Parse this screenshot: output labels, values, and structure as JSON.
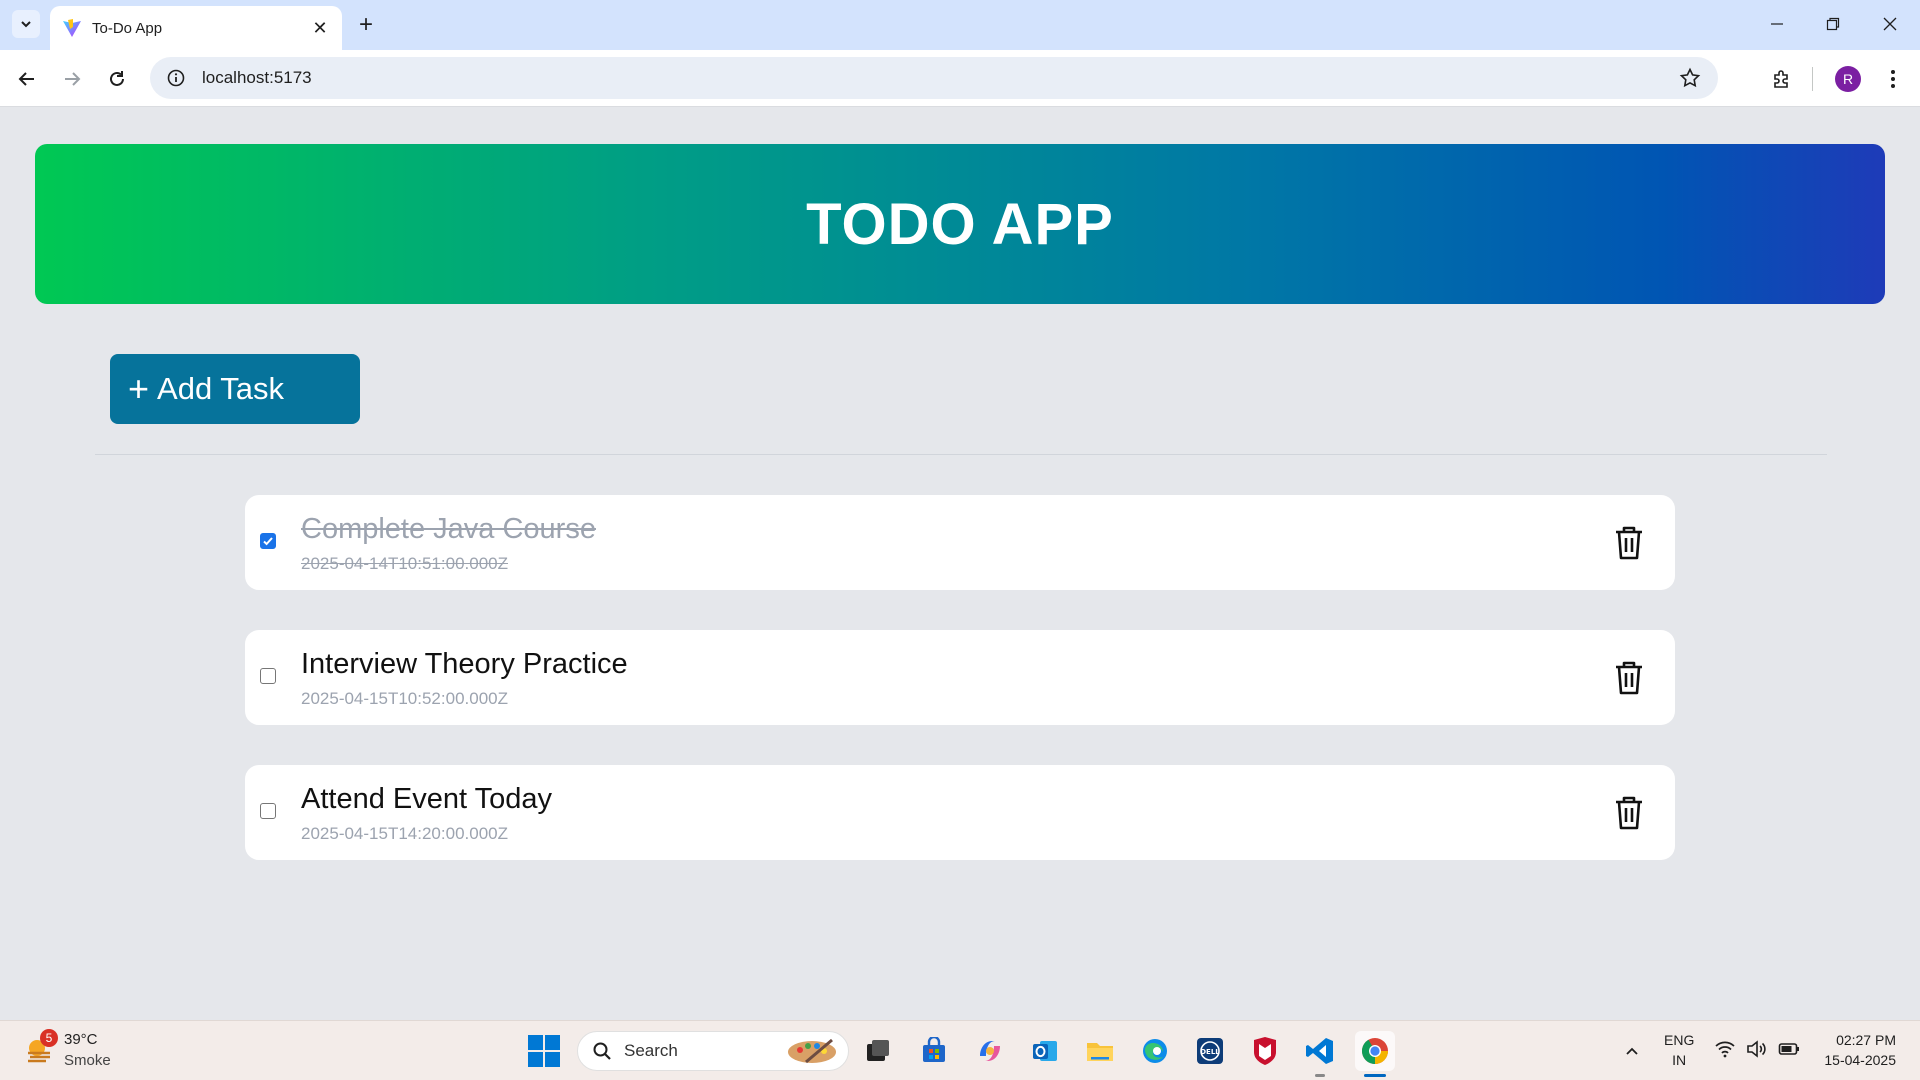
{
  "browser": {
    "tab_title": "To-Do App",
    "url": "localhost:5173",
    "profile_initial": "R"
  },
  "app": {
    "title": "TODO APP",
    "add_button_label": "Add Task",
    "add_button_icon": "plus-icon",
    "colors": {
      "header_gradient": [
        "#00c853",
        "#009e85",
        "#0077a6",
        "#0055b3",
        "#1e3bb8"
      ],
      "add_button": "#06739b",
      "page_background": "#e5e7eb"
    },
    "tasks": [
      {
        "title": "Complete Java Course",
        "date": "2025-04-14T10:51:00.000Z",
        "completed": true
      },
      {
        "title": "Interview Theory Practice",
        "date": "2025-04-15T10:52:00.000Z",
        "completed": false
      },
      {
        "title": "Attend Event Today",
        "date": "2025-04-15T14:20:00.000Z",
        "completed": false
      }
    ]
  },
  "taskbar": {
    "weather_temp": "39°C",
    "weather_desc": "Smoke",
    "weather_badge": "5",
    "search_label": "Search",
    "lang_line1": "ENG",
    "lang_line2": "IN",
    "time": "02:27 PM",
    "date": "15-04-2025"
  }
}
